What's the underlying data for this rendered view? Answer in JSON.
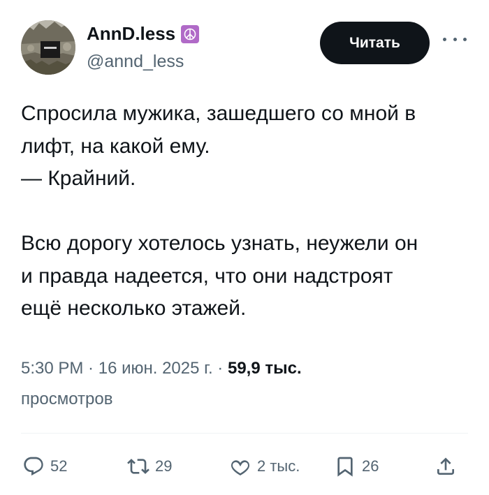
{
  "author": {
    "display_name": "AnnD.less",
    "handle": "@annd_less",
    "badge_icon": "peace-icon",
    "badge_color": "#b06ac7"
  },
  "header": {
    "follow_label": "Читать",
    "more_icon": "more-icon"
  },
  "tweet": {
    "lines": [
      "Спросила мужика, зашедшего со мной в",
      "лифт, на какой ему.",
      "— Крайний.",
      "",
      "Всю дорогу хотелось узнать, неужели он",
      "и правда надеется, что они надстроят",
      "ещё несколько этажей."
    ]
  },
  "meta": {
    "time": "5:30 PM",
    "separator": " · ",
    "date": "16 июн. 2025 г.",
    "views_count": "59,9 тыс.",
    "views_label": "просмотров"
  },
  "actions": {
    "replies": "52",
    "reposts": "29",
    "likes": "2 тыс.",
    "bookmarks": "26"
  },
  "colors": {
    "text": "#0f1419",
    "secondary": "#536471",
    "button_bg": "#0f1419",
    "button_text": "#ffffff"
  }
}
